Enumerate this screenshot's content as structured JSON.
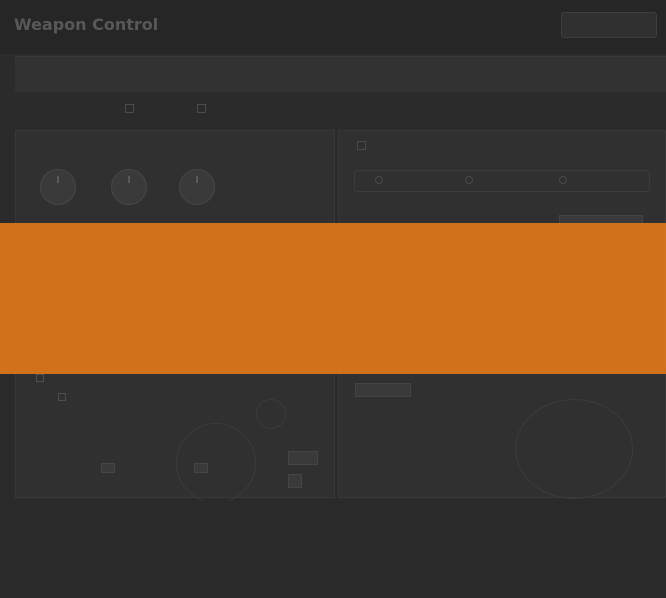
{
  "app": {
    "title": "Weapon Control",
    "top_button": ""
  },
  "toolbar": {
    "crumbs": [
      "",
      "",
      ""
    ]
  },
  "tabs": [
    "",
    "",
    "",
    "",
    ""
  ],
  "left_panel": {
    "header": "",
    "knobs": [
      {
        "label": "",
        "sub": ""
      },
      {
        "label": "",
        "sub": ""
      },
      {
        "label": "",
        "sub": ""
      }
    ],
    "section2": "",
    "section3": "",
    "checkbox_label": "",
    "sub_label": ""
  },
  "right_panel": {
    "header": "",
    "segments": [
      "",
      "",
      ""
    ],
    "section2": "",
    "field_label": ""
  },
  "colors": {
    "overlay": "#e0771a",
    "background": "#2b2b2b"
  }
}
